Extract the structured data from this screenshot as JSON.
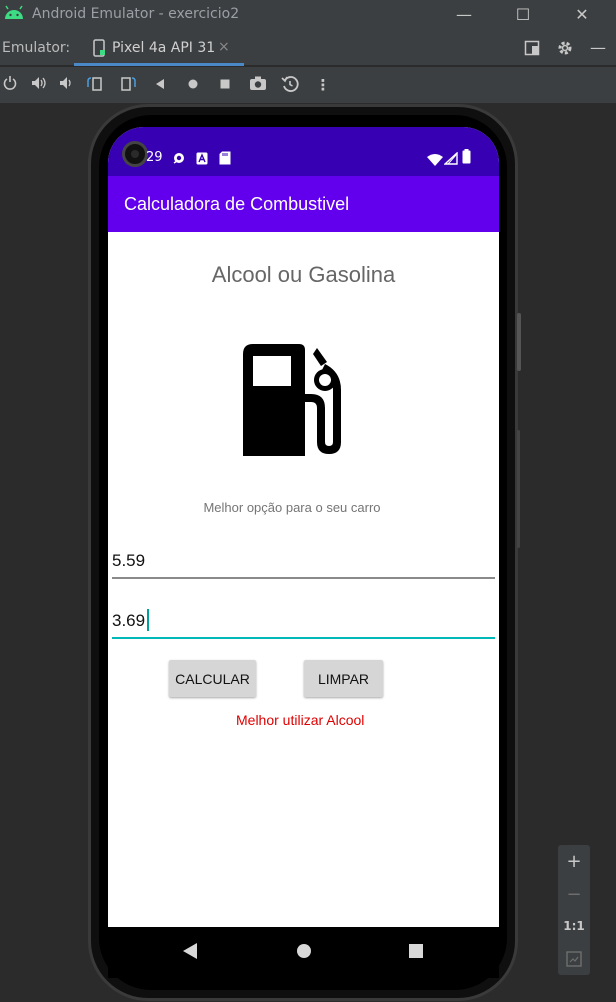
{
  "window": {
    "title": "Android Emulator - exercicio2",
    "minimize": "—",
    "maximize": "☐",
    "close": "✕"
  },
  "tabbar": {
    "label": "Emulator:",
    "device_tab": "Pixel 4a API 31",
    "close": "×"
  },
  "toolbar": {
    "icons": [
      "power-icon",
      "volume-up-icon",
      "volume-down-icon",
      "rotate-left-icon",
      "rotate-right-icon",
      "back-icon",
      "home-icon",
      "overview-icon",
      "screenshot-icon",
      "snapshot-icon",
      "more-icon"
    ]
  },
  "device": {
    "status_time": "29",
    "app_title": "Calculadora de Combustivel",
    "headline": "Alcool ou Gasolina",
    "subtitle": "Melhor opção para o seu carro",
    "field1_value": "5.59",
    "field2_value": "3.69",
    "calc_button": "CALCULAR",
    "clear_button": "LIMPAR",
    "result": "Melhor utilizar Alcool"
  },
  "zoom_panel": {
    "zoom_in": "+",
    "zoom_out": "−",
    "actual_size": "1:1"
  },
  "colors": {
    "status_bar": "#3700b3",
    "app_bar": "#6200ee",
    "accent": "#00b8b8",
    "result_text": "#e00000"
  }
}
